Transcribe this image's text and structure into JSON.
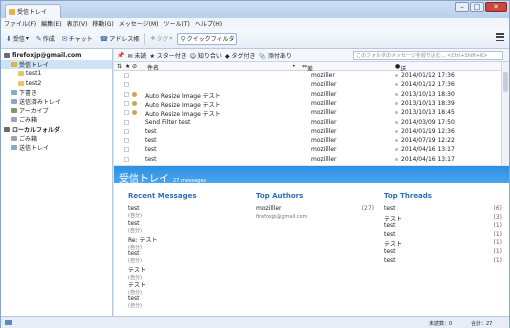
{
  "window": {
    "tab_title": "受信トレイ",
    "min_glyph": "–",
    "max_glyph": "□",
    "close_glyph": "✕"
  },
  "menubar": [
    "ファイル(F)",
    "編集(E)",
    "表示(V)",
    "移動(G)",
    "メッセージ(M)",
    "ツール(T)",
    "ヘルプ(H)"
  ],
  "toolbar": {
    "receive": "受信",
    "compose": "作成",
    "chat": "チャット",
    "address": "アドレス帳",
    "tag": "タグ",
    "quickfilter": "クイックフィルタ"
  },
  "folders": [
    {
      "label": "firefoxjp@gmail.com",
      "bold": true,
      "indent": 3,
      "color": "#6b6b6b"
    },
    {
      "label": "受信トレイ",
      "sel": true,
      "indent": 10,
      "color": "#e3b247"
    },
    {
      "label": "test1",
      "indent": 17,
      "color": "#e9c56a"
    },
    {
      "label": "test2",
      "indent": 17,
      "color": "#e9c56a"
    },
    {
      "label": "下書き",
      "indent": 10,
      "color": "#8aa9cf"
    },
    {
      "label": "送信済みトレイ",
      "indent": 10,
      "color": "#8aa9cf"
    },
    {
      "label": "アーカイブ",
      "indent": 10,
      "color": "#7c9c64"
    },
    {
      "label": "ごみ箱",
      "indent": 10,
      "color": "#9aa6b4"
    },
    {
      "label": "ローカルフォルダ",
      "bold": true,
      "indent": 3,
      "color": "#6b6b6b"
    },
    {
      "label": "ごみ箱",
      "indent": 10,
      "color": "#9aa6b4"
    },
    {
      "label": "送信トレイ",
      "indent": 10,
      "color": "#8aa9cf"
    }
  ],
  "threadbar": {
    "unread": "未読",
    "starred": "スター付き",
    "contacts": "知り合い",
    "tags": "タグ付き",
    "attach": "添付あり",
    "search_placeholder": "このフォルダのメッセージを絞り込む... <Ctrl+Shift+K>"
  },
  "columns": {
    "subject": "件名",
    "from": "差出人",
    "date": "送信日時"
  },
  "messages": [
    {
      "subject": "",
      "from": "moziller",
      "date": "2014/01/12 17:36",
      "att": false
    },
    {
      "subject": "",
      "from": "mozilller",
      "date": "2014/01/12 17:36",
      "att": false
    },
    {
      "subject": "Auto Resize Image テスト",
      "from": "mozilller",
      "date": "2013/10/13 18:30",
      "att": true
    },
    {
      "subject": "Auto Resize Image テスト",
      "from": "mozilller",
      "date": "2013/10/13 18:39",
      "att": true
    },
    {
      "subject": "Auto Resize Image  テスト",
      "from": "mozilller",
      "date": "2013/10/13 18:45",
      "att": true
    },
    {
      "subject": "Send Filter test",
      "from": "mozilller",
      "date": "2014/03/09 17:50",
      "att": false
    },
    {
      "subject": "test",
      "from": "mozilller",
      "date": "2014/01/19 12:36",
      "att": false
    },
    {
      "subject": "test",
      "from": "mozilller",
      "date": "2014/07/19 12:22",
      "att": false
    },
    {
      "subject": "test",
      "from": "mozilller",
      "date": "2014/04/16 13:17",
      "att": false
    },
    {
      "subject": "test",
      "from": "mozilller",
      "date": "2014/04/16 13:17",
      "att": false
    }
  ],
  "summary": {
    "title": "受信トレイ",
    "count": "27 messages",
    "recent_title": "Recent Messages",
    "recent": [
      {
        "s": "test",
        "f": "(自分)"
      },
      {
        "s": "test",
        "f": "(自分)"
      },
      {
        "s": "Re: テスト",
        "f": "(自分)"
      },
      {
        "s": "test",
        "f": "(自分)"
      },
      {
        "s": "テスト",
        "f": "(自分)"
      },
      {
        "s": "テスト",
        "f": "(自分)"
      },
      {
        "s": "test",
        "f": "(自分)"
      }
    ],
    "authors_title": "Top Authors",
    "authors": [
      {
        "name": "mozilller",
        "count": "(27)",
        "mail": "firefoxjp@gmail.com"
      }
    ],
    "threads_title": "Top Threads",
    "threads": [
      {
        "n": "test",
        "c": "(6)"
      },
      {
        "n": "テスト",
        "c": "(3)"
      },
      {
        "n": "test",
        "c": "(1)"
      },
      {
        "n": "test",
        "c": "(1)"
      },
      {
        "n": "テスト",
        "c": "(1)"
      },
      {
        "n": "test",
        "c": "(1)"
      },
      {
        "n": "test",
        "c": "(1)"
      }
    ]
  },
  "status": {
    "unread": "未読数：0",
    "total": "合計：27"
  }
}
